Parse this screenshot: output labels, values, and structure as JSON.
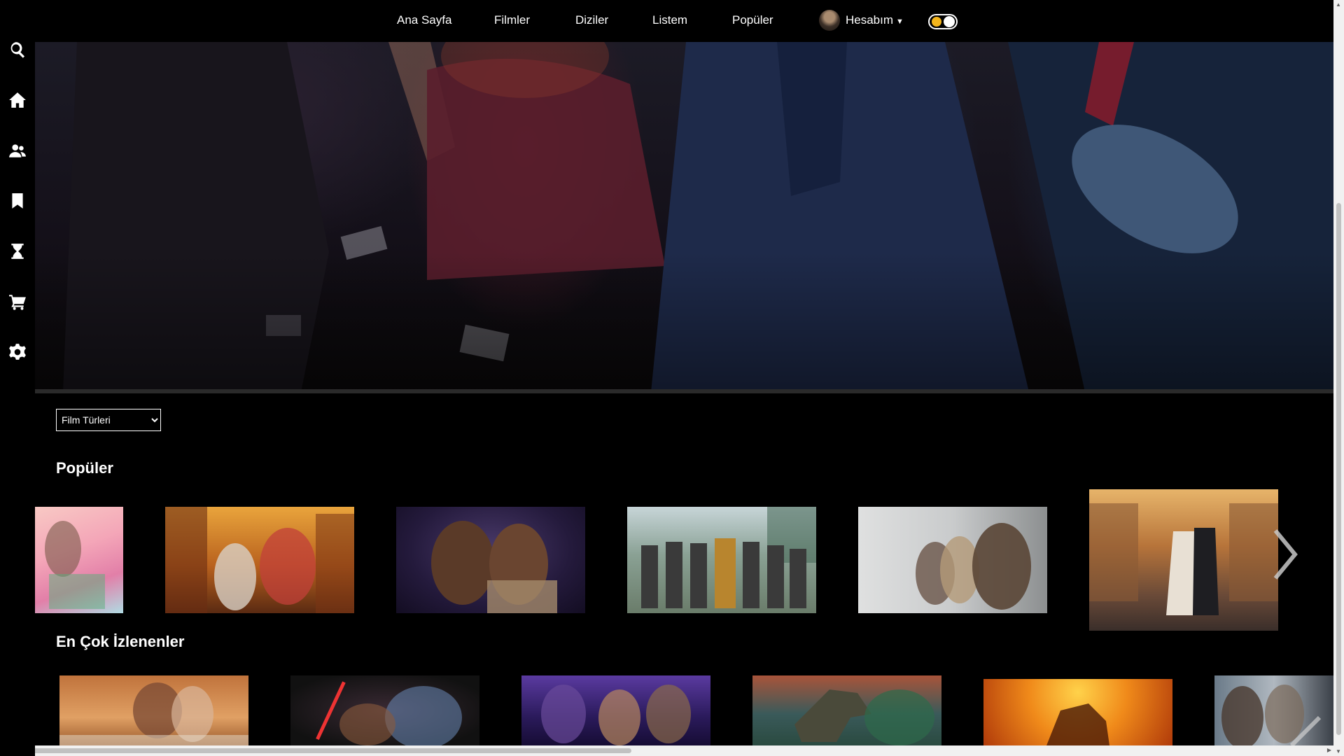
{
  "nav": {
    "items": [
      "Ana Sayfa",
      "Filmler",
      "Diziler",
      "Listem",
      "Popüler"
    ],
    "account_label": "Hesabım"
  },
  "sidebar": {
    "icons": [
      "search-icon",
      "home-icon",
      "users-icon",
      "bookmark-icon",
      "hourglass-icon",
      "cart-icon",
      "settings-icon"
    ]
  },
  "genre_select": {
    "selected": "Film Türleri"
  },
  "sections": {
    "popular": {
      "title": "Popüler"
    },
    "most_watched": {
      "title": "En Çok İzlenenler"
    }
  },
  "theme": {
    "toggle_accent": "#f3b51c",
    "background": "#000000"
  }
}
